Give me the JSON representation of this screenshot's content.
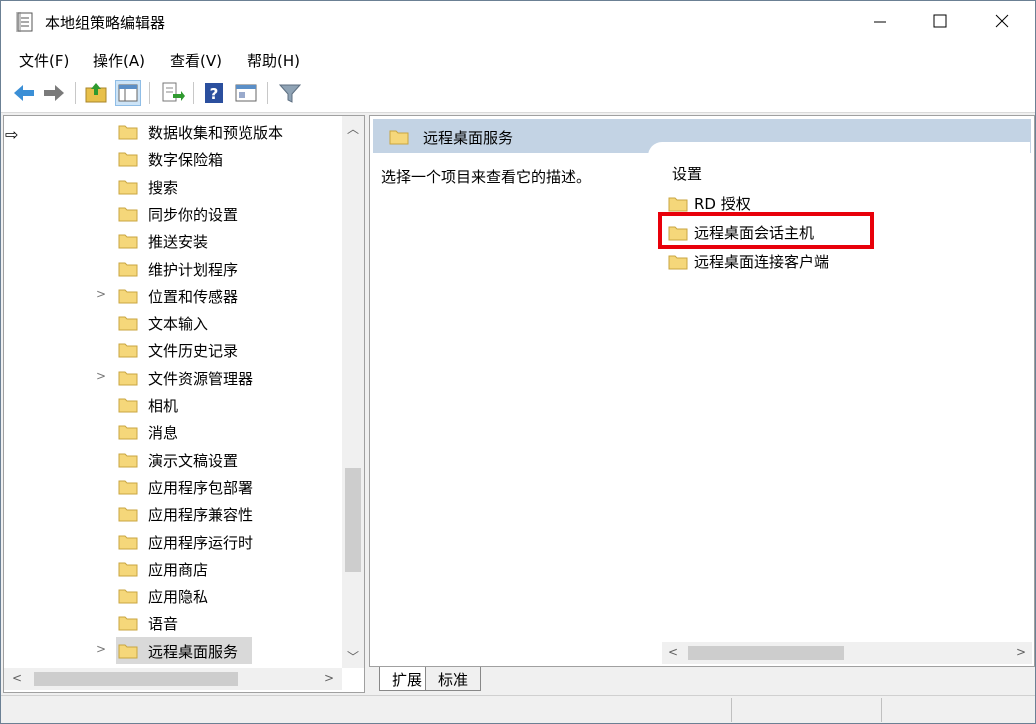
{
  "window": {
    "title": "本地组策略编辑器",
    "minimize_glyph": "—",
    "maximize_glyph": "☐",
    "close_glyph": "✕"
  },
  "menu": [
    "文件(F)",
    "操作(A)",
    "查看(V)",
    "帮助(H)"
  ],
  "toolbar": {
    "icons": [
      "back-icon",
      "forward-icon",
      "up-folder-icon",
      "show-hide-tree-icon",
      "export-list-icon",
      "help-icon",
      "properties-icon",
      "filter-icon"
    ]
  },
  "tree": {
    "items": [
      {
        "label": "数据收集和预览版本",
        "expandable": false
      },
      {
        "label": "数字保险箱",
        "expandable": false
      },
      {
        "label": "搜索",
        "expandable": false
      },
      {
        "label": "同步你的设置",
        "expandable": false
      },
      {
        "label": "推送安装",
        "expandable": false
      },
      {
        "label": "维护计划程序",
        "expandable": false
      },
      {
        "label": "位置和传感器",
        "expandable": true
      },
      {
        "label": "文本输入",
        "expandable": false
      },
      {
        "label": "文件历史记录",
        "expandable": false
      },
      {
        "label": "文件资源管理器",
        "expandable": true
      },
      {
        "label": "相机",
        "expandable": false
      },
      {
        "label": "消息",
        "expandable": false
      },
      {
        "label": "演示文稿设置",
        "expandable": false
      },
      {
        "label": "应用程序包部署",
        "expandable": false
      },
      {
        "label": "应用程序兼容性",
        "expandable": false
      },
      {
        "label": "应用程序运行时",
        "expandable": false
      },
      {
        "label": "应用商店",
        "expandable": false
      },
      {
        "label": "应用隐私",
        "expandable": false
      },
      {
        "label": "语音",
        "expandable": false
      },
      {
        "label": "远程桌面服务",
        "expandable": true,
        "selected": true
      }
    ]
  },
  "right": {
    "header_title": "远程桌面服务",
    "description": "选择一个项目来查看它的描述。",
    "column_header": "设置",
    "items": [
      "RD 授权",
      "远程桌面会话主机",
      "远程桌面连接客户端"
    ],
    "highlighted_item": "远程桌面会话主机"
  },
  "tabs": [
    "扩展",
    "标准"
  ],
  "colors": {
    "header_bg": "#c3d3e4",
    "highlight_border": "#e8000a",
    "folder_yellow": "#f5d77a"
  }
}
